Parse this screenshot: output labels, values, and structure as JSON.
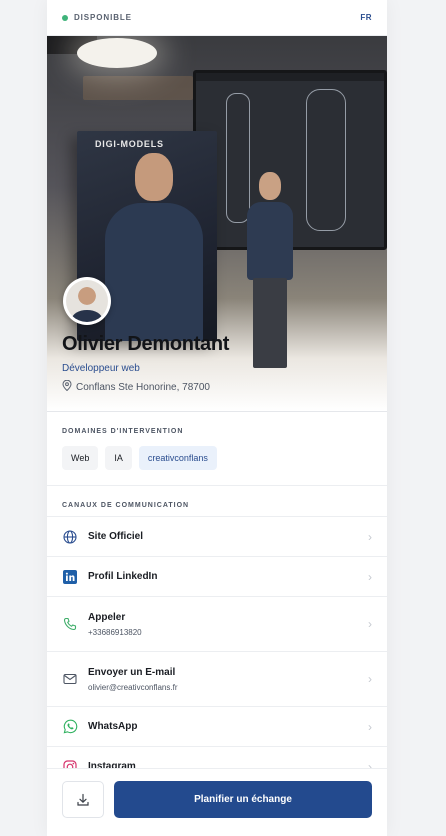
{
  "topbar": {
    "status": "DISPONIBLE",
    "lang": "FR"
  },
  "hero": {
    "box_title": "DIGI-MODELS"
  },
  "profile": {
    "name": "Olivier Demontant",
    "role": "Développeur web",
    "location": "Conflans Ste Honorine, 78700"
  },
  "domains": {
    "title": "DOMAINES D'INTERVENTION",
    "chips": [
      "Web",
      "IA",
      "creativconflans"
    ]
  },
  "channels": {
    "title": "CANAUX DE COMMUNICATION",
    "items": [
      {
        "label": "Site Officiel",
        "sub": "",
        "icon": "globe-icon"
      },
      {
        "label": "Profil LinkedIn",
        "sub": "",
        "icon": "linkedin-icon"
      },
      {
        "label": "Appeler",
        "sub": "+33686913820",
        "icon": "phone-icon"
      },
      {
        "label": "Envoyer un E-mail",
        "sub": "olivier@creativconflans.fr",
        "icon": "mail-icon"
      },
      {
        "label": "WhatsApp",
        "sub": "",
        "icon": "whatsapp-icon"
      },
      {
        "label": "Instagram",
        "sub": "",
        "icon": "instagram-icon"
      }
    ]
  },
  "footer": {
    "primary_label": "Planifier un échange"
  },
  "colors": {
    "accent": "#234a8e",
    "status": "#3fb37a",
    "link": "#2a4d8f"
  }
}
